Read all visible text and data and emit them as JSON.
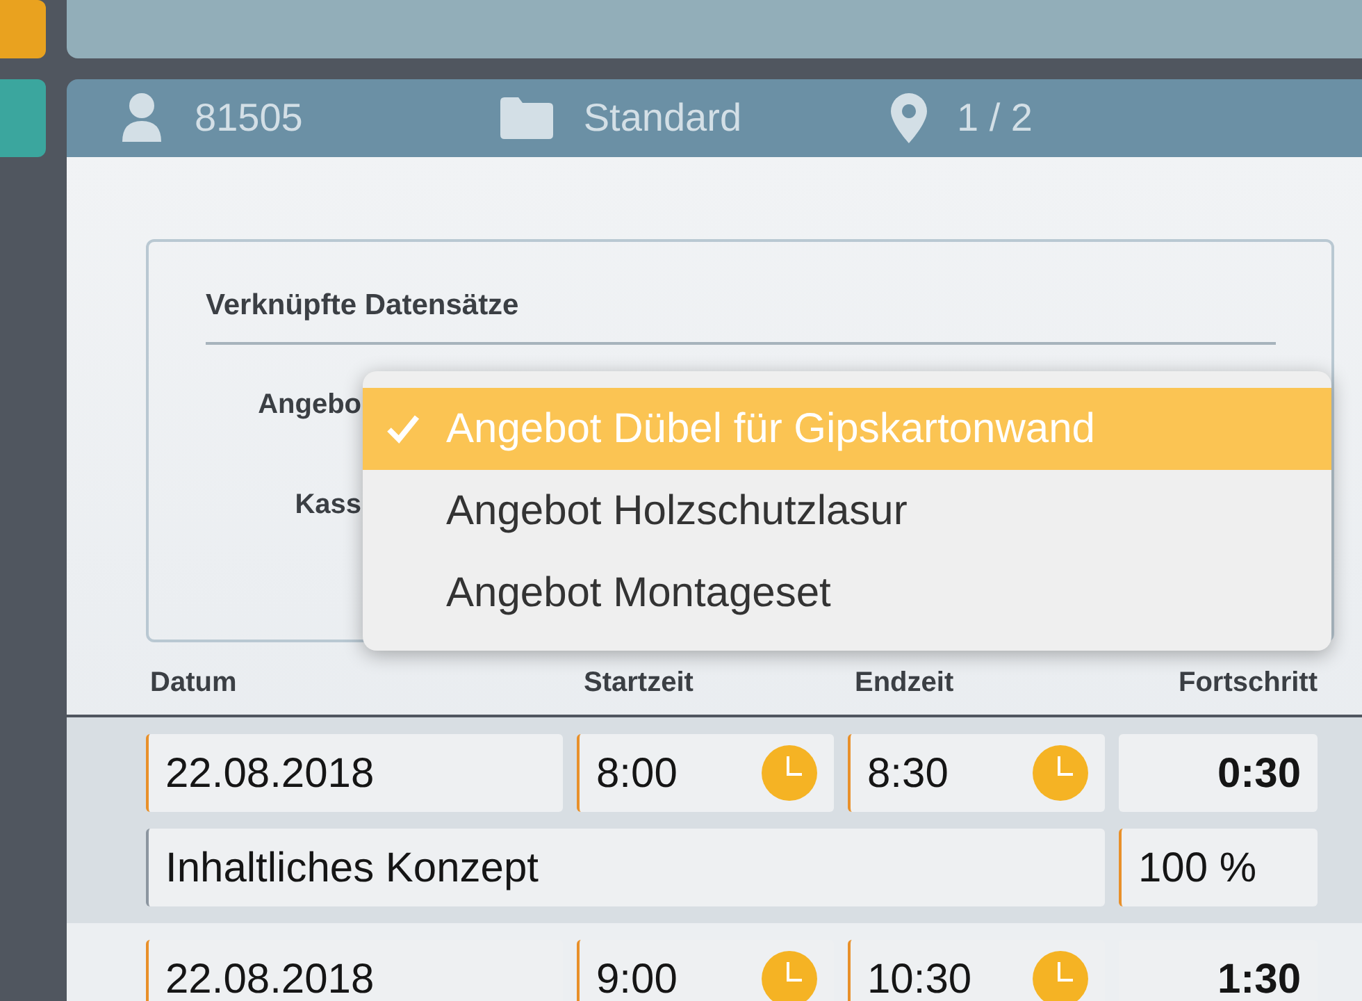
{
  "sidebar": {
    "tiles": [
      {
        "color": "#e9a21f"
      },
      {
        "color": "#3ba69e"
      }
    ]
  },
  "header": {
    "user": "81505",
    "folder": "Standard",
    "position": "1 / 2"
  },
  "linked_records": {
    "title": "Verknüpfte Datensätze",
    "fields": [
      {
        "label": "Angebo"
      },
      {
        "label": "Kass"
      }
    ]
  },
  "dropdown": {
    "options": [
      {
        "label": "Angebot Dübel für Gipskartonwand",
        "selected": true
      },
      {
        "label": "Angebot Holzschutzlasur",
        "selected": false
      },
      {
        "label": "Angebot Montageset",
        "selected": false
      }
    ]
  },
  "table": {
    "columns": [
      "Datum",
      "Startzeit",
      "Endzeit",
      "Fortschritt"
    ],
    "rows": [
      {
        "selected": true,
        "date": "22.08.2018",
        "start": "8:00",
        "end": "8:30",
        "duration": "0:30",
        "description": "Inhaltliches Konzept",
        "progress": "100 %"
      },
      {
        "selected": false,
        "date": "22.08.2018",
        "start": "9:00",
        "end": "10:30",
        "duration": "1:30"
      }
    ]
  }
}
